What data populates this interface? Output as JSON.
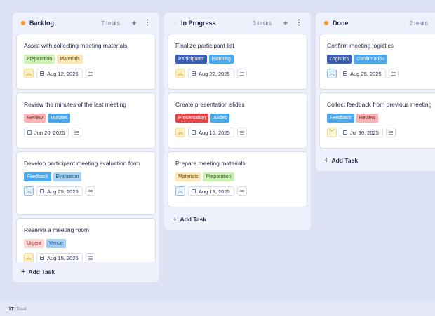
{
  "columns": [
    {
      "title": "Backlog",
      "count": "7 tasks",
      "dot": "#f29a2e",
      "add_label": "Add Task",
      "cards": [
        {
          "title": "Assist with collecting meeting materials",
          "tags": [
            {
              "label": "Preparation",
              "bg": "#cdf0b4",
              "fg": "#2f5c1e"
            },
            {
              "label": "Materials",
              "bg": "#fde7b8",
              "fg": "#6d4a0a"
            }
          ],
          "priority": "high",
          "priority_icon": "double-chevron-up",
          "date": "Aug 12, 2025"
        },
        {
          "title": "Review the minutes of the last meeting",
          "tags": [
            {
              "label": "Review",
              "bg": "#f8b4b4",
              "fg": "#7a1f1f"
            },
            {
              "label": "Minutes",
              "bg": "#4ea7e8",
              "fg": "#ffffff"
            }
          ],
          "priority": "none",
          "date": "Jun 20, 2025"
        },
        {
          "title": "Develop participant meeting evaluation form",
          "tags": [
            {
              "label": "Feedback",
              "bg": "#4ea7e8",
              "fg": "#ffffff"
            },
            {
              "label": "Evaluation",
              "bg": "#a9d3f3",
              "fg": "#1e4b73"
            }
          ],
          "priority": "medium",
          "priority_icon": "chevron-up",
          "date": "Aug 25, 2025"
        },
        {
          "title": "Reserve a meeting room",
          "tags": [
            {
              "label": "Urgent",
              "bg": "#fbd3d3",
              "fg": "#8a2a2a"
            },
            {
              "label": "Venue",
              "bg": "#9fcdf2",
              "fg": "#1e4b73"
            }
          ],
          "priority": "high",
          "priority_icon": "double-chevron-up",
          "date": "Aug 15, 2025"
        }
      ]
    },
    {
      "title": "In Progress",
      "count": "3 tasks",
      "dot": "#eef0fb",
      "add_label": "Add Task",
      "cards": [
        {
          "title": "Finalize participant list",
          "tags": [
            {
              "label": "Participants",
              "bg": "#3c5fb0",
              "fg": "#ffffff"
            },
            {
              "label": "Planning",
              "bg": "#4ea7e8",
              "fg": "#ffffff"
            }
          ],
          "priority": "high",
          "priority_icon": "double-chevron-up",
          "date": "Aug 22, 2025"
        },
        {
          "title": "Create presentation slides",
          "tags": [
            {
              "label": "Presentation",
              "bg": "#e0474a",
              "fg": "#ffffff"
            },
            {
              "label": "Slides",
              "bg": "#4ea7e8",
              "fg": "#ffffff"
            }
          ],
          "priority": "high",
          "priority_icon": "double-chevron-up",
          "date": "Aug 16, 2025"
        },
        {
          "title": "Prepare meeting materials",
          "tags": [
            {
              "label": "Materials",
              "bg": "#fde7b8",
              "fg": "#6d4a0a"
            },
            {
              "label": "Preparation",
              "bg": "#cdf0b4",
              "fg": "#2f5c1e"
            }
          ],
          "priority": "medium",
          "priority_icon": "chevron-up",
          "date": "Aug 18, 2025"
        }
      ]
    },
    {
      "title": "Done",
      "count": "2 tasks",
      "dot": "#f29a2e",
      "add_label": "Add Task",
      "cards": [
        {
          "title": "Confirm meeting logistics",
          "tags": [
            {
              "label": "Logistics",
              "bg": "#3c5fb0",
              "fg": "#ffffff"
            },
            {
              "label": "Confirmation",
              "bg": "#4ea7e8",
              "fg": "#ffffff"
            }
          ],
          "priority": "medium",
          "priority_icon": "chevron-up",
          "date": "Aug 25, 2025"
        },
        {
          "title": "Collect feedback from previous meeting",
          "tags": [
            {
              "label": "Feedback",
              "bg": "#4ea7e8",
              "fg": "#ffffff"
            },
            {
              "label": "Review",
              "bg": "#f8b4b4",
              "fg": "#7a1f1f"
            }
          ],
          "priority": "low",
          "priority_icon": "chevron-down",
          "date": "Jul 30, 2025"
        }
      ]
    }
  ],
  "footer": {
    "total_count": "17",
    "total_label": "Total"
  }
}
